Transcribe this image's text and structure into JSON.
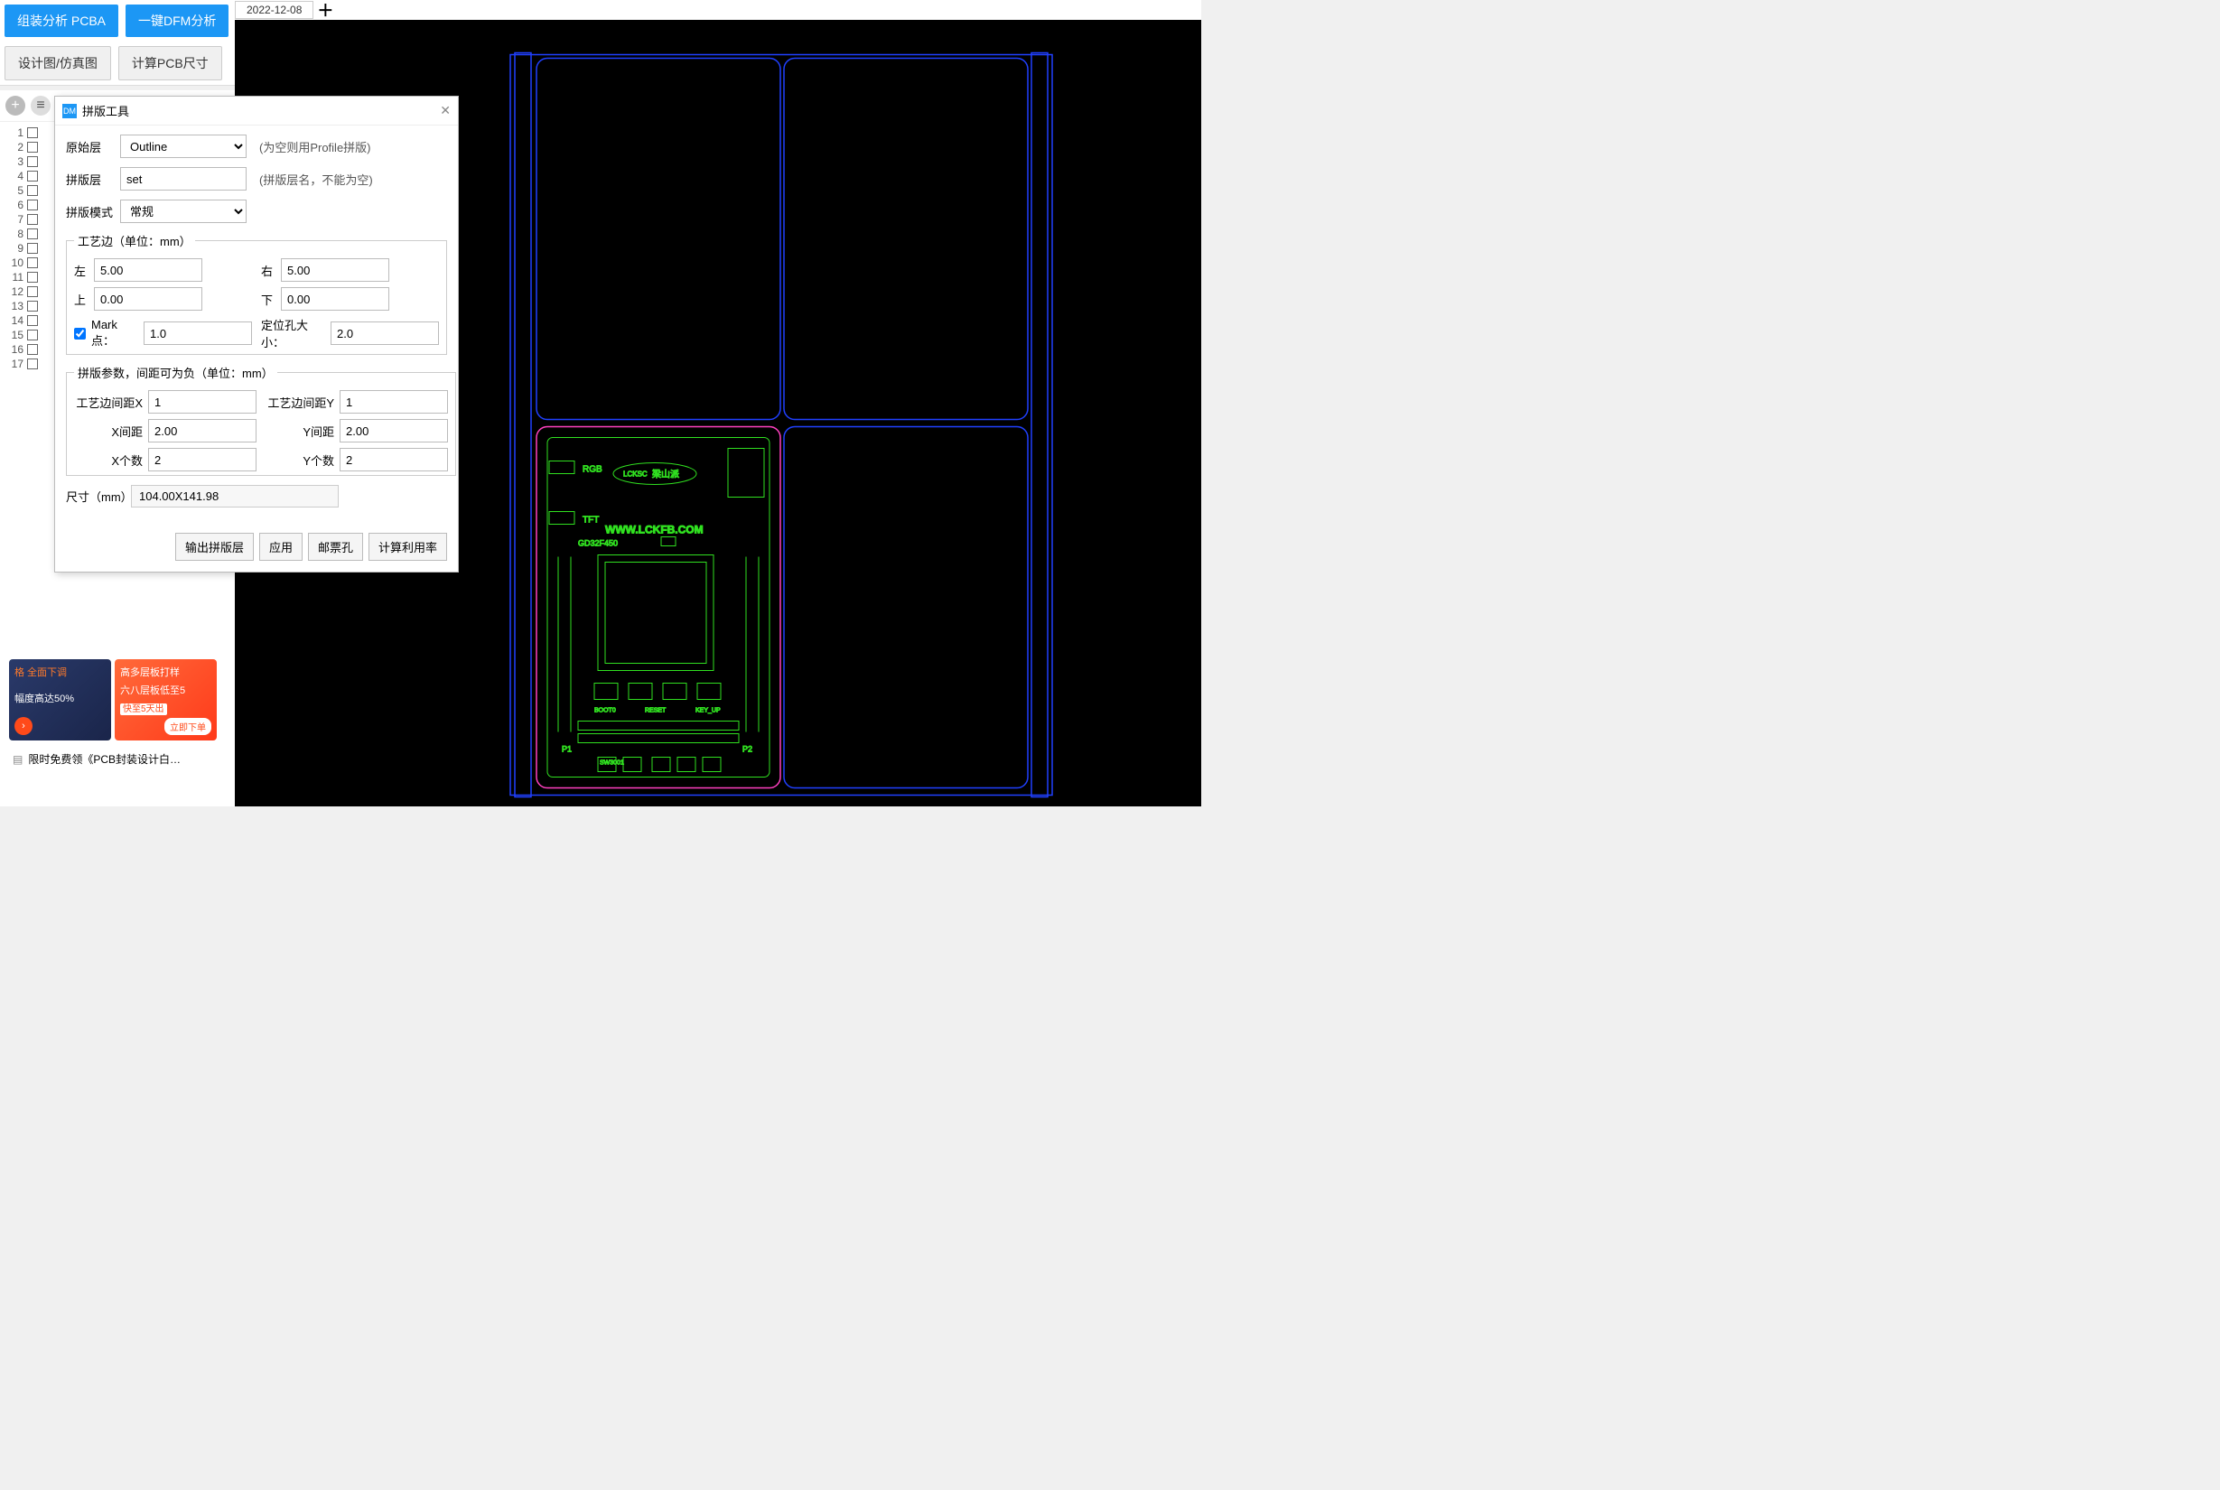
{
  "toolbar": {
    "assembly_analysis": "组装分析 PCBA",
    "dfm_analysis": "一键DFM分析",
    "design_view": "设计图/仿真图",
    "calc_pcb_size": "计算PCB尺寸"
  },
  "tabs": {
    "active": "2022-12-08"
  },
  "layers": {
    "count": 17
  },
  "dialog": {
    "title": "拼版工具",
    "source_layer_label": "原始层",
    "source_layer_value": "Outline",
    "source_layer_hint": "(为空则用Profile拼版)",
    "panel_layer_label": "拼版层",
    "panel_layer_value": "set",
    "panel_layer_hint": "(拼版层名，不能为空)",
    "mode_label": "拼版模式",
    "mode_value": "常规",
    "edge": {
      "legend": "工艺边（单位：mm）",
      "left_label": "左",
      "left_value": "5.00",
      "right_label": "右",
      "right_value": "5.00",
      "top_label": "上",
      "top_value": "0.00",
      "bottom_label": "下",
      "bottom_value": "0.00",
      "mark_label": "Mark点：",
      "mark_value": "1.0",
      "hole_label": "定位孔大小：",
      "hole_value": "2.0"
    },
    "params": {
      "legend": "拼版参数，间距可为负（单位：mm）",
      "edge_gap_x_label": "工艺边间距X",
      "edge_gap_x_value": "1",
      "edge_gap_y_label": "工艺边间距Y",
      "edge_gap_y_value": "1",
      "x_gap_label": "X间距",
      "x_gap_value": "2.00",
      "y_gap_label": "Y间距",
      "y_gap_value": "2.00",
      "x_count_label": "X个数",
      "x_count_value": "2",
      "y_count_label": "Y个数",
      "y_count_value": "2"
    },
    "size_label": "尺寸（mm）",
    "size_value": "104.00X141.98",
    "buttons": {
      "export_layer": "输出拼版层",
      "apply": "应用",
      "stamp_hole": "邮票孔",
      "calc_util": "计算利用率"
    }
  },
  "ads": {
    "a1_l1": "格 全面下调",
    "a1_l2": "幅度高达50%",
    "a2_l1": "高多层板打样",
    "a2_l2": "六八层板低至5",
    "a2_l3": "快至5天出",
    "a2_btn": "立即下单",
    "link": "限时免费领《PCB封装设计白…"
  },
  "pcb": {
    "rgb_label": "RGB",
    "tft_label": "TFT",
    "logo_text": "LCKSC",
    "brand_text": "梁山派",
    "website": "WWW.LCKFB.COM",
    "chip": "GD32F450",
    "p1": "P1",
    "p2": "P2",
    "boot0": "BOOT0",
    "reset": "RESET",
    "keyup": "KEY_UP",
    "sw_text": "SW3001"
  }
}
